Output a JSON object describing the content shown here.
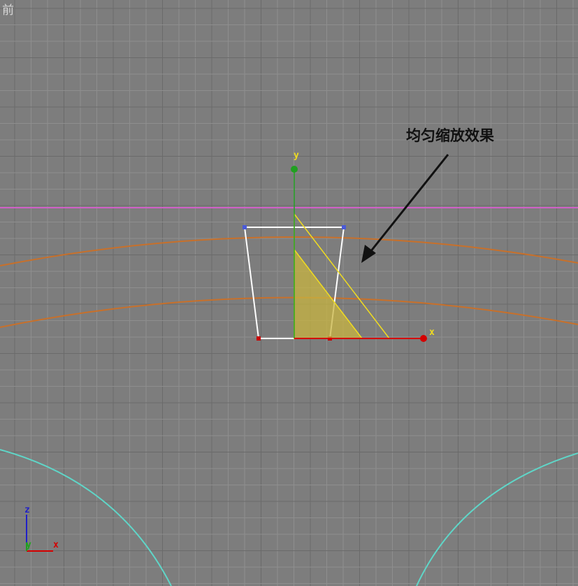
{
  "viewport": {
    "label": "前",
    "name": "Front"
  },
  "annotation": {
    "text": "均匀缩放效果"
  },
  "gizmo": {
    "x_label": "x",
    "y_label": "y"
  },
  "axis_tripod": {
    "z_label": "z",
    "y_label": "y",
    "x_label": "x"
  },
  "colors": {
    "background": "#7d7d7d",
    "grid": "#8e8e8e",
    "grid_major": "#6a6a6a",
    "horizon_line": "#d060c8",
    "orange_arcs": "#c8702a",
    "cyan_arcs": "#5fd6c8",
    "selected_object": "#ffffff",
    "triangle_fill": "#c8b440",
    "triangle_stroke": "#f0dc20",
    "gizmo_x": "#d40000",
    "gizmo_y": "#20a020",
    "gizmo_label": "#f0dc20",
    "tripod_z": "#2020c8",
    "tripod_y": "#20a020",
    "tripod_x": "#d40000",
    "arrow": "#111111"
  }
}
